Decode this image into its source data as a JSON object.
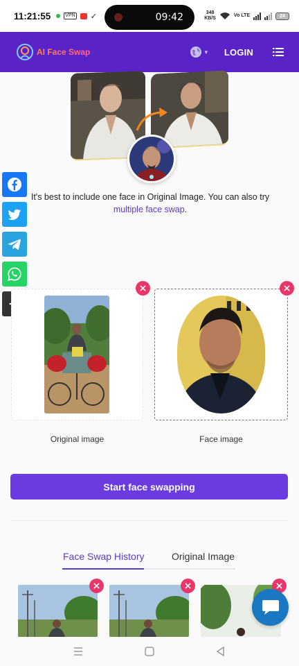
{
  "status_bar": {
    "time": "11:21:55",
    "island_time": "09:42",
    "vpn_label": "VPN",
    "net_speed_top": "348",
    "net_speed_bottom": "KB/S",
    "lte_label": "Vo LTE",
    "battery": "24"
  },
  "header": {
    "logo_text": "AI Face Swap",
    "login_label": "LOGIN",
    "accent_color": "#5a23c8"
  },
  "info": {
    "text": "It's best to include one face in Original Image. You can also try ",
    "link_text": "multiple face swap",
    "suffix": "."
  },
  "social": {
    "items": [
      "facebook-icon",
      "twitter-icon",
      "telegram-icon",
      "whatsapp-icon",
      "plus-icon"
    ]
  },
  "upload": {
    "original_label": "Original image",
    "face_label": "Face image"
  },
  "actions": {
    "start_label": "Start face swapping",
    "button_color": "#6a3be1"
  },
  "tabs": {
    "history_label": "Face Swap History",
    "original_label": "Original Image"
  },
  "colors": {
    "close_badge": "#e8366a",
    "chat_button": "#1a78c2"
  }
}
